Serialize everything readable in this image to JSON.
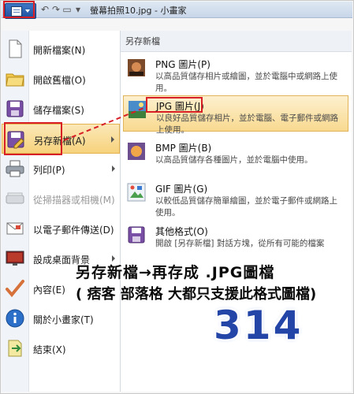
{
  "window": {
    "title": "螢幕拍照10.jpg - 小畫家"
  },
  "quick_access": [
    "↶",
    "↷",
    "▭",
    "▾"
  ],
  "menu": {
    "items": [
      {
        "label": "開新檔案(N)",
        "icon": "new-file-icon"
      },
      {
        "label": "開啟舊檔(O)",
        "icon": "open-folder-icon"
      },
      {
        "label": "儲存檔案(S)",
        "icon": "save-disk-icon"
      },
      {
        "label": "另存新檔(A)",
        "icon": "save-as-icon"
      },
      {
        "label": "列印(P)",
        "icon": "printer-icon"
      },
      {
        "label": "從掃描器或相機(M)",
        "icon": "scanner-icon"
      },
      {
        "label": "以電子郵件傳送(D)",
        "icon": "email-icon"
      },
      {
        "label": "設成桌面背景",
        "icon": "desktop-background-icon"
      },
      {
        "label": "內容(E)",
        "icon": "checkmark-icon"
      },
      {
        "label": "關於小畫家(T)",
        "icon": "info-icon"
      },
      {
        "label": "結束(X)",
        "icon": "exit-icon"
      }
    ]
  },
  "submenu": {
    "header": "另存新檔",
    "items": [
      {
        "title": "PNG 圖片(P)",
        "desc": "以高品質儲存相片或繪圖，並於電腦中或網路上使用。",
        "icon": "png-image-icon"
      },
      {
        "title": "JPG 圖片(J)",
        "desc": "以良好品質儲存相片，並於電腦、電子郵件或網路上使用。",
        "icon": "jpg-image-icon"
      },
      {
        "title": "BMP 圖片(B)",
        "desc": "以高品質儲存各種圖片，並於電腦中使用。",
        "icon": "bmp-image-icon"
      },
      {
        "title": "GIF 圖片(G)",
        "desc": "以較低品質儲存簡單繪圖，並於電子郵件或網路上使用。",
        "icon": "gif-image-icon"
      },
      {
        "title": "其他格式(O)",
        "desc": "開啟 [另存新檔] 對話方塊，從所有可能的檔案",
        "icon": "other-format-icon"
      }
    ]
  },
  "annotation": {
    "line1": "另存新檔→再存成 .JPG圖檔",
    "line2": "( 痞客 部落格 大都只支援此格式圖檔)",
    "number": "314",
    "color": "#d81f26"
  }
}
